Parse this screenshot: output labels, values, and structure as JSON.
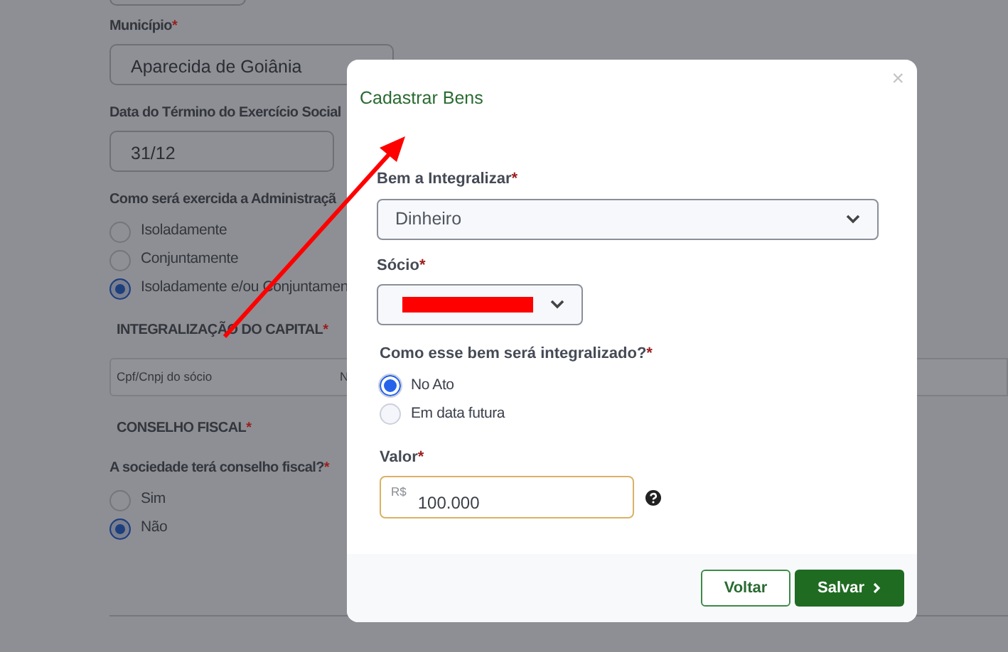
{
  "background_form": {
    "fields": [
      {
        "label": "Município",
        "required": "*",
        "value": "Aparecida de Goiânia",
        "kind": "wide"
      },
      {
        "label": "Data do Término do Exercício Social",
        "value": "31/12",
        "kind": "narrow"
      }
    ],
    "administration": {
      "label": "Como será exercida a Administraçã",
      "options": [
        {
          "label": "Isoladamente",
          "selected": false
        },
        {
          "label": "Conjuntamente",
          "selected": false
        },
        {
          "label": "Isoladamente e/ou Conjuntamen",
          "selected": true
        }
      ]
    },
    "capital_section": {
      "heading": "INTEGRALIZAÇÃO DO CAPITAL",
      "required": "*",
      "columns": [
        "Cpf/Cnpj do sócio",
        "N"
      ]
    },
    "fiscal_section": {
      "heading": "CONSELHO FISCAL",
      "required": "*",
      "question": "A sociedade terá conselho fiscal?",
      "question_required": "*",
      "options": [
        {
          "label": "Sim",
          "selected": false
        },
        {
          "label": "Não",
          "selected": true
        }
      ]
    }
  },
  "modal": {
    "title": "Cadastrar Bens",
    "close": "×",
    "bem": {
      "label": "Bem a Integralizar",
      "required": "*",
      "value": "Dinheiro"
    },
    "socio": {
      "label": "Sócio",
      "required": "*",
      "redacted": true
    },
    "integration": {
      "label": "Como esse bem será integralizado?",
      "required": "*",
      "options": [
        {
          "label": "No Ato",
          "selected": true
        },
        {
          "label": "Em data futura",
          "selected": false
        }
      ]
    },
    "valor": {
      "label": "Valor",
      "required": "*",
      "prefix": "R$",
      "value": "100.000"
    },
    "buttons": [
      {
        "label": "Voltar",
        "kind": "outline"
      },
      {
        "label": "Salvar",
        "kind": "primary",
        "chevron": true
      }
    ]
  }
}
